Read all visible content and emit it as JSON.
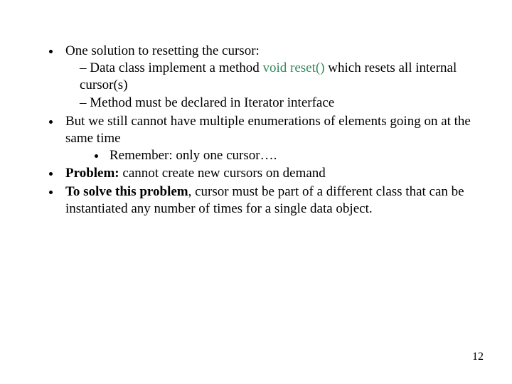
{
  "bullets": {
    "b1": "One solution to resetting the cursor:",
    "b1a_pre": "Data class implement a method ",
    "b1a_code": " void reset()",
    "b1a_post": " which resets all internal cursor(s)",
    "b1b": "Method must be declared in Iterator interface",
    "b2": "But we still cannot have multiple enumerations of elements going on at the same time",
    "b2a": "Remember: only one cursor….",
    "b3_bold": "Problem:",
    "b3_rest": " cannot create new cursors on demand",
    "b4_bold": "To solve this problem",
    "b4_rest": ", cursor must be part of a different class that can be instantiated any number of times for a single data object."
  },
  "page_number": "12"
}
